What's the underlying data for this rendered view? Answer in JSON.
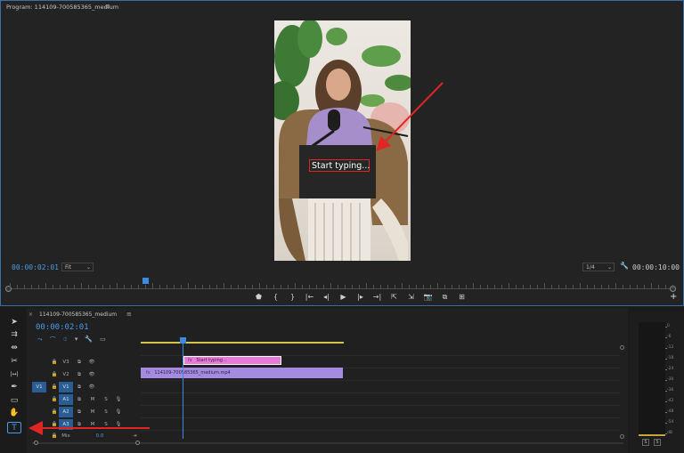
{
  "program_monitor": {
    "title": "Program: 114109-700585365_medium",
    "menu_icon": "≡",
    "video_overlay_text": "Start typing...",
    "timecode_current": "00:00:02:01",
    "zoom_select": "Fit",
    "resolution_select": "1/4",
    "timecode_duration": "00:00:10:00",
    "transport_icons": [
      "marker-icon",
      "in-point-icon",
      "out-point-icon",
      "go-to-in-icon",
      "step-back-icon",
      "play-icon",
      "step-forward-icon",
      "go-to-out-icon",
      "lift-icon",
      "extract-icon",
      "export-frame-icon",
      "button-editor-icon",
      "safe-margins-icon"
    ],
    "transport_glyphs": [
      "⬟",
      "{",
      "}",
      "|←",
      "◂|",
      "▶",
      "|▸",
      "→|",
      "⇱",
      "⇲",
      "📷",
      "⧉",
      "⊞"
    ],
    "add_button": "+",
    "wrench": "🔧"
  },
  "timeline": {
    "sequence_name": "114109-700585365_medium",
    "close_glyph": "×",
    "menu_icon": "≡",
    "timecode": "00:00:02:01",
    "toolbar_glyphs": [
      "⤳",
      "⌒",
      "⯐",
      "▾",
      "🔧",
      "▭"
    ],
    "tracks": [
      {
        "lock": "🔒",
        "src": "",
        "name": "V3",
        "sync": "⧉",
        "eye": "👁",
        "m": "",
        "s": "",
        "mic": ""
      },
      {
        "lock": "🔒",
        "src": "",
        "name": "V2",
        "sync": "⧉",
        "eye": "👁",
        "m": "",
        "s": "",
        "mic": ""
      },
      {
        "lock": "🔒",
        "src": "V1",
        "name": "V1",
        "sync": "⧉",
        "eye": "👁",
        "m": "",
        "s": "",
        "mic": ""
      },
      {
        "lock": "🔒",
        "src": "",
        "name": "A1",
        "sync": "⧉",
        "eye": "",
        "m": "M",
        "s": "S",
        "mic": "🎙"
      },
      {
        "lock": "🔒",
        "src": "",
        "name": "A2",
        "sync": "⧉",
        "eye": "",
        "m": "M",
        "s": "S",
        "mic": "🎙"
      },
      {
        "lock": "🔒",
        "src": "",
        "name": "A3",
        "sync": "⧉",
        "eye": "",
        "m": "M",
        "s": "S",
        "mic": "🎙"
      }
    ],
    "mix": {
      "label": "Mix",
      "value": "0.0",
      "end_glyph": "⇥"
    },
    "clips": {
      "graphic": "Start typing...",
      "video": "114109-700585365_medium.mp4",
      "fx_glyph": "fx"
    }
  },
  "tools": [
    {
      "name": "selection-tool",
      "glyph": "➤"
    },
    {
      "name": "track-select-tool",
      "glyph": "⇉"
    },
    {
      "name": "ripple-edit-tool",
      "glyph": "⇹"
    },
    {
      "name": "razor-tool",
      "glyph": "✂"
    },
    {
      "name": "slip-tool",
      "glyph": "|↔|"
    },
    {
      "name": "pen-tool",
      "glyph": "✒"
    },
    {
      "name": "rectangle-tool",
      "glyph": "▭"
    },
    {
      "name": "hand-tool",
      "glyph": "✋"
    },
    {
      "name": "type-tool",
      "glyph": "T"
    }
  ],
  "audio_meter": {
    "labels": [
      "0",
      "-6",
      "-12",
      "-18",
      "-24",
      "-30",
      "-36",
      "-42",
      "-48",
      "-54",
      "dB"
    ],
    "solo_buttons": [
      "S",
      "S"
    ]
  },
  "colors": {
    "accent_blue": "#4a9be8",
    "graphic_clip": "#e77ad8",
    "video_clip": "#a48ae0",
    "work_area": "#d4c44a",
    "annotation_red": "#e02525"
  }
}
